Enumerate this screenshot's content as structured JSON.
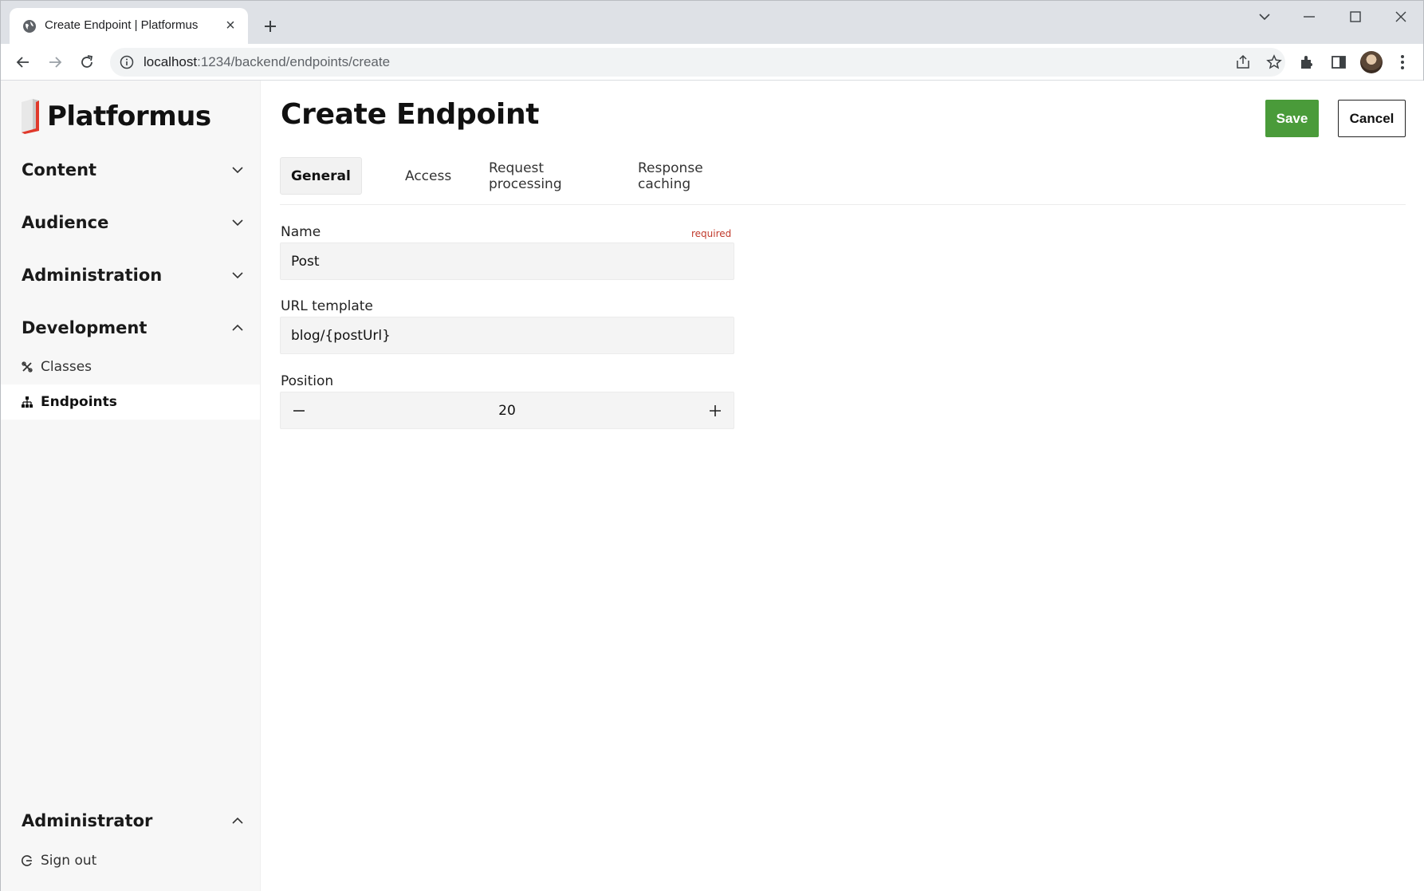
{
  "browser": {
    "tab_title": "Create Endpoint | Platformus",
    "url_host": "localhost",
    "url_rest": ":1234/backend/endpoints/create"
  },
  "sidebar": {
    "logo_text": "Platformus",
    "sections": [
      {
        "label": "Content",
        "expanded": false
      },
      {
        "label": "Audience",
        "expanded": false
      },
      {
        "label": "Administration",
        "expanded": false
      },
      {
        "label": "Development",
        "expanded": true
      }
    ],
    "dev_items": [
      {
        "label": "Classes",
        "icon": "classes-icon",
        "active": false
      },
      {
        "label": "Endpoints",
        "icon": "endpoints-icon",
        "active": true
      }
    ],
    "user_section": {
      "label": "Administrator",
      "expanded": true
    },
    "sign_out": "Sign out"
  },
  "main": {
    "title": "Create Endpoint",
    "save_label": "Save",
    "cancel_label": "Cancel",
    "tabs": [
      {
        "label": "General",
        "active": true
      },
      {
        "label": "Access",
        "active": false
      },
      {
        "label": "Request processing",
        "active": false
      },
      {
        "label": "Response caching",
        "active": false
      }
    ],
    "fields": {
      "name": {
        "label": "Name",
        "required_text": "required",
        "value": "Post"
      },
      "url_template": {
        "label": "URL template",
        "value": "blog/{postUrl}"
      },
      "position": {
        "label": "Position",
        "value": "20"
      }
    }
  },
  "colors": {
    "save": "#4a9b3a",
    "required": "#c0392b",
    "logo_accent": "#e0392b"
  }
}
